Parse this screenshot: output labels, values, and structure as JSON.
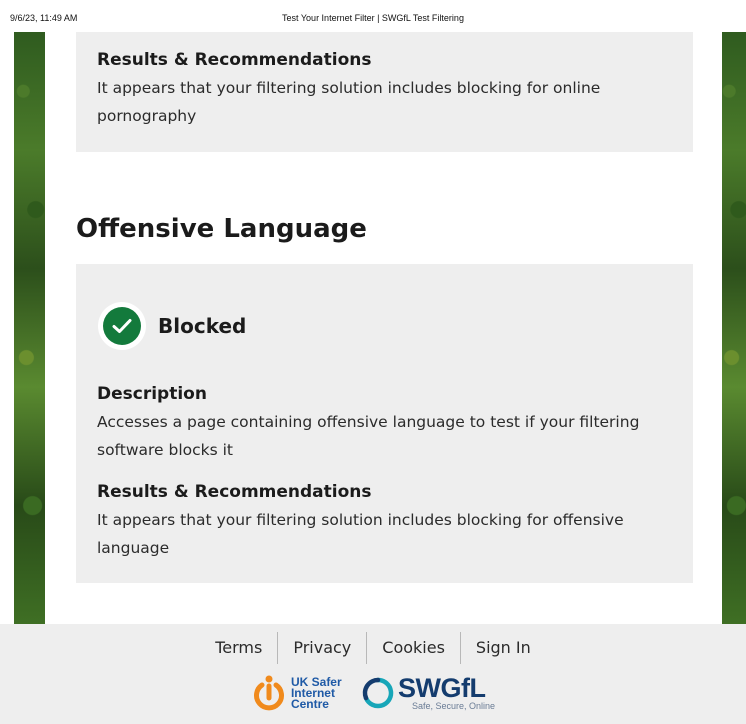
{
  "print_header": {
    "datetime": "9/6/23, 11:49 AM",
    "title": "Test Your Internet Filter | SWGfL Test Filtering"
  },
  "previous_result": {
    "results_heading": "Results & Recommendations",
    "results_text": "It appears that your filtering solution includes blocking for online pornography"
  },
  "offensive_language": {
    "title": "Offensive Language",
    "status": "Blocked",
    "status_color": "#137a3c",
    "status_icon": "check-circle",
    "description_heading": "Description",
    "description_text": "Accesses a page containing offensive language to test if your filtering software blocks it",
    "results_heading": "Results & Recommendations",
    "results_text": "It appears that your filtering solution includes blocking for offensive language"
  },
  "footer": {
    "links": [
      "Terms",
      "Privacy",
      "Cookies",
      "Sign In"
    ],
    "uk_safer_logo_text": "UK Safer Internet Centre",
    "swgfl_logo_name": "SWGfL",
    "swgfl_tagline": "Safe, Secure, Online"
  }
}
